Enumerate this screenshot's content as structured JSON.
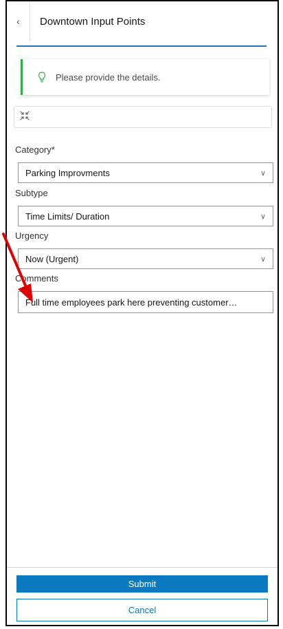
{
  "header": {
    "back_icon": "chevron-left-icon",
    "title": "Downtown Input Points"
  },
  "tip": {
    "icon": "lightbulb-icon",
    "text": "Please provide the details."
  },
  "toolbar": {
    "icon": "collapse-icon"
  },
  "form": {
    "category": {
      "label": "Category*",
      "value": "Parking Improvments"
    },
    "subtype": {
      "label": "Subtype",
      "value": "Time Limits/ Duration"
    },
    "urgency": {
      "label": "Urgency",
      "value": "Now (Urgent)"
    },
    "comments": {
      "label": "Comments",
      "value": "Full time employees park here preventing customer…"
    }
  },
  "actions": {
    "submit": "Submit",
    "cancel": "Cancel"
  },
  "colors": {
    "accent": "#0a79bf",
    "tip_border": "#35ac46",
    "arrow": "#e00000"
  }
}
